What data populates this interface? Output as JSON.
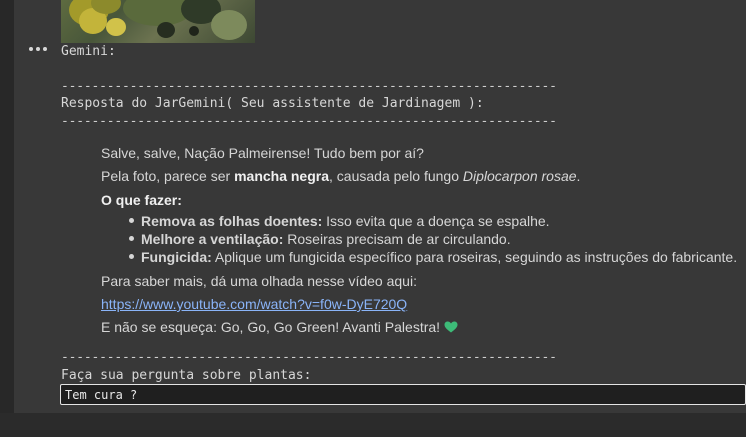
{
  "output": {
    "image_alt": "leaf-photo",
    "gemini_label": "Gemini:",
    "separator_top": "-----------------------------------------------------------------",
    "response_header": "Resposta do JarGemini( Seu assistente de Jardinagem ):",
    "separator_mid": "-----------------------------------------------------------------",
    "separator_bottom": "-----------------------------------------------------------------",
    "prompt_label": "Faça sua pergunta sobre plantas:"
  },
  "answer": {
    "greeting": "Salve, salve, Nação Palmeirense! Tudo bem por aí?",
    "diagnosis_prefix": "Pela foto, parece ser ",
    "diagnosis_bold": "mancha negra",
    "diagnosis_middle": ", causada pelo fungo ",
    "diagnosis_italic": "Diplocarpon rosae",
    "diagnosis_suffix": ".",
    "what_to_do": "O que fazer:",
    "tips": [
      {
        "title": "Remova as folhas doentes:",
        "text": " Isso evita que a doença se espalhe."
      },
      {
        "title": "Melhore a ventilação:",
        "text": " Roseiras precisam de ar circulando."
      },
      {
        "title": "Fungicida:",
        "text": " Aplique um fungicida específico para roseiras, seguindo as instruções do fabricante."
      }
    ],
    "more_info": "Para saber mais, dá uma olhada nesse vídeo aqui:",
    "video_link": "https://www.youtube.com/watch?v=f0w-DyE720Q",
    "closing": "E não se esqueça: Go, Go, Go Green! Avanti Palestra!",
    "closing_icon": "green-heart-icon"
  },
  "input": {
    "value": "Tem cura ?"
  },
  "colors": {
    "background": "#383838",
    "link": "#8ab4f8",
    "heart": "#3dbb78"
  }
}
